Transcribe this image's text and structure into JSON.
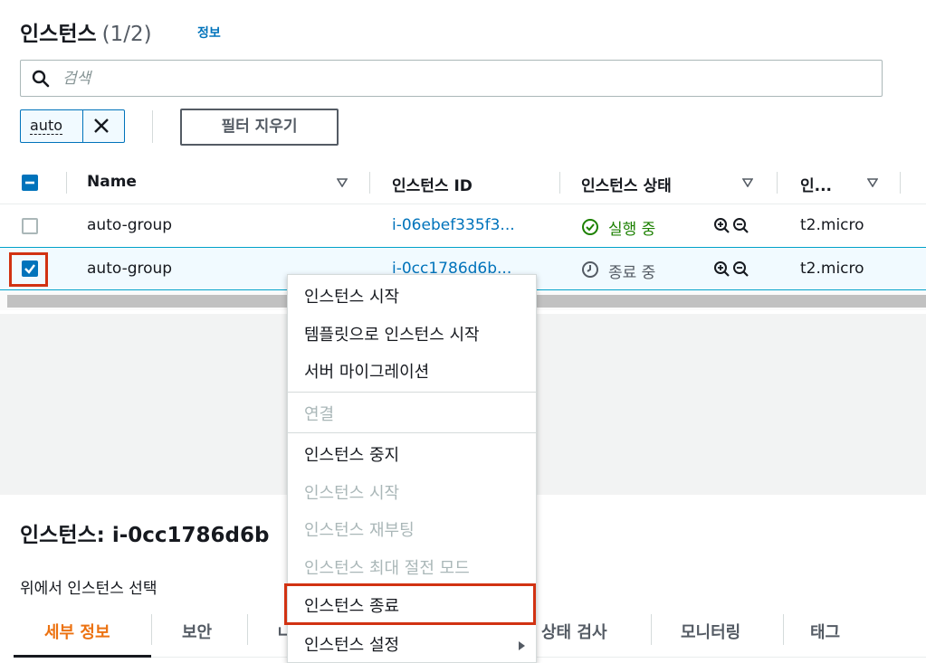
{
  "header": {
    "title": "인스턴스",
    "count": "(1/2)",
    "info_link": "정보"
  },
  "search": {
    "placeholder": "검색",
    "value": ""
  },
  "filter": {
    "token_label": "auto",
    "clear_button": "필터 지우기"
  },
  "table": {
    "columns": [
      "Name",
      "인스턴스 ID",
      "인스턴스 상태",
      "인..."
    ],
    "rows": [
      {
        "name": "auto-group",
        "instance_id": "i-06ebef335f3...",
        "state": "실행 중",
        "state_kind": "running",
        "type": "t2.micro",
        "selected": false
      },
      {
        "name": "auto-group",
        "instance_id": "i-0cc1786d6b...",
        "state": "종료 중",
        "state_kind": "shutting-down",
        "type": "t2.micro",
        "selected": true
      }
    ]
  },
  "context_menu": {
    "items": [
      {
        "label": "인스턴스 시작",
        "disabled": false
      },
      {
        "label": "템플릿으로 인스턴스 시작",
        "disabled": false
      },
      {
        "label": "서버 마이그레이션",
        "disabled": false
      },
      {
        "label": "연결",
        "disabled": true
      },
      {
        "label": "인스턴스 중지",
        "disabled": false
      },
      {
        "label": "인스턴스 시작",
        "disabled": true
      },
      {
        "label": "인스턴스 재부팅",
        "disabled": true
      },
      {
        "label": "인스턴스 최대 절전 모드",
        "disabled": true
      },
      {
        "label": "인스턴스 종료",
        "disabled": false,
        "highlighted": true
      },
      {
        "label": "인스턴스 설정",
        "disabled": false,
        "submenu": true
      }
    ]
  },
  "details": {
    "title": "인스턴스: i-0cc1786d6b",
    "subtitle": "위에서 인스턴스 선택",
    "tabs": [
      "세부 정보",
      "보안",
      "ㄴ",
      "상태 검사",
      "모니터링",
      "태그"
    ],
    "active_tab": "세부 정보"
  },
  "colors": {
    "link": "#0073bb",
    "running": "#1d8102",
    "highlight_border": "#d13212",
    "active_tab": "#ec7211"
  }
}
